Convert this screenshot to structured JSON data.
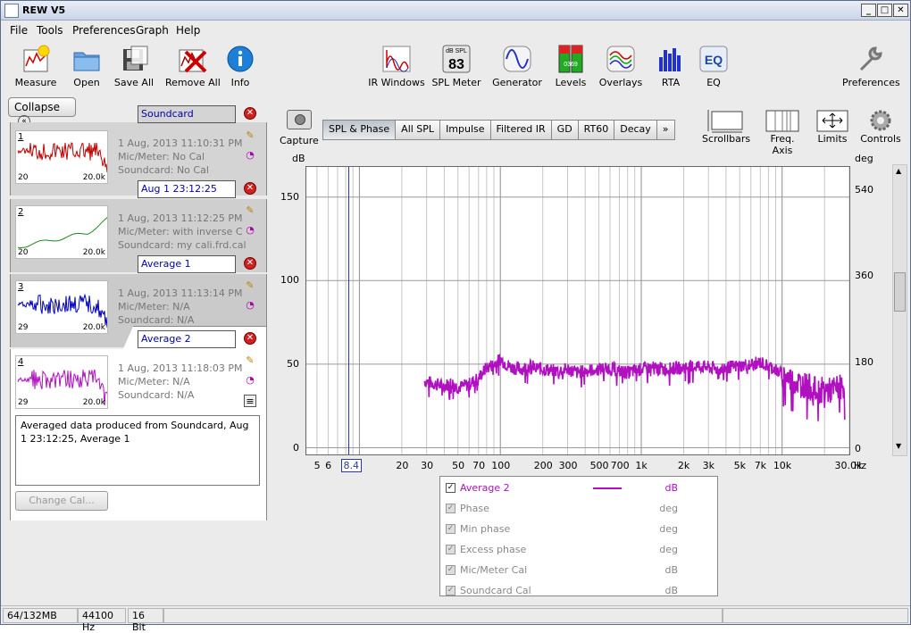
{
  "window": {
    "title": "REW V5"
  },
  "menu": [
    "File",
    "Tools",
    "Preferences",
    "Graph",
    "Help"
  ],
  "toolbar_left": [
    {
      "label": "Measure",
      "icon": "measure-icon"
    },
    {
      "label": "Open",
      "icon": "folder-icon"
    },
    {
      "label": "Save All",
      "icon": "save-icon"
    },
    {
      "label": "Remove All",
      "icon": "remove-icon"
    },
    {
      "label": "Info",
      "icon": "info-icon"
    }
  ],
  "toolbar_center": [
    {
      "label": "IR Windows",
      "icon": "ir-windows-icon"
    },
    {
      "label": "SPL Meter",
      "icon": "spl-meter-icon",
      "top": "dB SPL",
      "value": "83"
    },
    {
      "label": "Generator",
      "icon": "generator-icon"
    },
    {
      "label": "Levels",
      "icon": "levels-icon",
      "value": "0369"
    },
    {
      "label": "Overlays",
      "icon": "overlays-icon"
    },
    {
      "label": "RTA",
      "icon": "rta-icon"
    },
    {
      "label": "EQ",
      "icon": "eq-icon",
      "value": "EQ"
    }
  ],
  "toolbar_right": {
    "label": "Preferences",
    "icon": "wrench-icon"
  },
  "sidebar": {
    "collapse_label": "Collapse",
    "measurements": [
      {
        "name": "Soundcard",
        "num": "1",
        "date": "1 Aug, 2013 11:10:31 PM",
        "mic": "Mic/Meter: No Cal",
        "soundcard": "Soundcard: No Cal",
        "lo": "20",
        "hi": "20.0k",
        "color": "#c00000"
      },
      {
        "name": "Aug 1 23:12:25",
        "num": "2",
        "date": "1 Aug, 2013 11:12:25 PM",
        "mic": "Mic/Meter: with inverse C",
        "soundcard": "Soundcard: my cali.frd.cal",
        "lo": "20",
        "hi": "20.0k",
        "color": "#1a8a1a"
      },
      {
        "name": "Average 1",
        "num": "3",
        "date": "1 Aug, 2013 11:13:14 PM",
        "mic": "Mic/Meter: N/A",
        "soundcard": "Soundcard: N/A",
        "lo": "29",
        "hi": "20.0k",
        "color": "#0000c0"
      },
      {
        "name": "Average 2",
        "num": "4",
        "date": "1 Aug, 2013 11:18:03 PM",
        "mic": "Mic/Meter: N/A",
        "soundcard": "Soundcard: N/A",
        "lo": "29",
        "hi": "20.0k",
        "color": "#b010c0"
      }
    ],
    "notes": "Averaged data produced from Soundcard, Aug 1 23:12:25, Average 1",
    "change_cal_label": "Change Cal..."
  },
  "graph": {
    "capture_label": "Capture",
    "tabs": [
      "SPL & Phase",
      "All SPL",
      "Impulse",
      "Filtered IR",
      "GD",
      "RT60",
      "Decay",
      "»"
    ],
    "active_tab": "SPL & Phase",
    "right_tools": [
      {
        "label": "Scrollbars",
        "icon": "scrollbars-icon"
      },
      {
        "label": "Freq. Axis",
        "icon": "freq-axis-icon"
      },
      {
        "label": "Limits",
        "icon": "limits-icon"
      },
      {
        "label": "Controls",
        "icon": "gear-icon"
      }
    ],
    "left_unit": "dB",
    "right_unit": "deg",
    "cursor_label": "8.4",
    "x_unit": "Hz"
  },
  "chart_data": {
    "type": "line",
    "x_scale": "log",
    "xlim": [
      4.2,
      30000
    ],
    "ylim": [
      -4,
      168
    ],
    "y2lim": [
      -12,
      588
    ],
    "x_tick_labels": [
      {
        "v": 5,
        "t": "5"
      },
      {
        "v": 6,
        "t": "6"
      },
      {
        "v": 20,
        "t": "20"
      },
      {
        "v": 30,
        "t": "30"
      },
      {
        "v": 50,
        "t": "50"
      },
      {
        "v": 70,
        "t": "70"
      },
      {
        "v": 100,
        "t": "100"
      },
      {
        "v": 200,
        "t": "200"
      },
      {
        "v": 300,
        "t": "300"
      },
      {
        "v": 500,
        "t": "500"
      },
      {
        "v": 700,
        "t": "700"
      },
      {
        "v": 1000,
        "t": "1k"
      },
      {
        "v": 2000,
        "t": "2k"
      },
      {
        "v": 3000,
        "t": "3k"
      },
      {
        "v": 5000,
        "t": "5k"
      },
      {
        "v": 7000,
        "t": "7k"
      },
      {
        "v": 10000,
        "t": "10k"
      },
      {
        "v": 30000,
        "t": "30.0k"
      }
    ],
    "y_ticks": [
      0,
      50,
      100,
      150
    ],
    "y2_ticks": [
      0,
      180,
      360,
      540
    ],
    "cursor_x": 8.4,
    "series": [
      {
        "name": "Average 2",
        "color": "#b010c0",
        "x": [
          29,
          35,
          40,
          45,
          50,
          55,
          60,
          65,
          70,
          75,
          80,
          90,
          100,
          110,
          120,
          140,
          160,
          180,
          200,
          250,
          300,
          350,
          400,
          500,
          600,
          700,
          800,
          1000,
          1200,
          1500,
          2000,
          2500,
          3000,
          3500,
          4000,
          5000,
          6000,
          7000,
          8000,
          9000,
          10000,
          12000,
          14000,
          16000,
          18000,
          20000,
          22000,
          25000,
          28000
        ],
        "y": [
          40,
          38,
          37,
          39,
          36,
          37,
          38,
          40,
          42,
          45,
          48,
          50,
          53,
          50,
          48,
          47,
          49,
          48,
          47,
          46,
          47,
          45,
          46,
          47,
          48,
          46,
          45,
          47,
          48,
          47,
          48,
          49,
          48,
          47,
          48,
          49,
          50,
          51,
          49,
          47,
          44,
          40,
          38,
          36,
          34,
          35,
          34,
          36,
          37
        ]
      }
    ],
    "legend": [
      {
        "name": "Average 2",
        "unit": "dB",
        "checked": true,
        "enabled": true
      },
      {
        "name": "Phase",
        "unit": "deg",
        "checked": true,
        "enabled": false
      },
      {
        "name": "Min phase",
        "unit": "deg",
        "checked": true,
        "enabled": false
      },
      {
        "name": "Excess phase",
        "unit": "deg",
        "checked": true,
        "enabled": false
      },
      {
        "name": "Mic/Meter Cal",
        "unit": "dB",
        "checked": true,
        "enabled": false
      },
      {
        "name": "Soundcard Cal",
        "unit": "dB",
        "checked": true,
        "enabled": false
      }
    ]
  },
  "status": [
    "64/132MB",
    "44100 Hz",
    "16 Bit"
  ]
}
